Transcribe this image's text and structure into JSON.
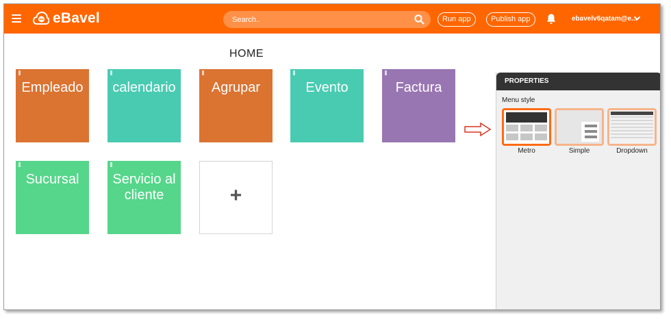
{
  "app": {
    "name": "eBavel",
    "logo_icon": "cloud-e-logo-icon"
  },
  "header": {
    "search_placeholder": "Search..",
    "run_app_label": "Run app",
    "publish_app_label": "Publish app",
    "user_email": "ebavelv6qatam@e...",
    "icons": [
      "hamburger-menu-icon",
      "search-icon",
      "bell-icon",
      "chevron-down-icon"
    ]
  },
  "home": {
    "title": "HOME",
    "tiles": [
      {
        "label": "Empleado",
        "color": "#db7331"
      },
      {
        "label": "calendario",
        "color": "#49cbb1"
      },
      {
        "label": "Agrupar",
        "color": "#db7331"
      },
      {
        "label": "Evento",
        "color": "#49cbb1"
      },
      {
        "label": "Factura",
        "color": "#9876b2"
      },
      {
        "label": "Sucursal",
        "color": "#55d68a"
      },
      {
        "label": "Servicio al cliente",
        "color": "#55d68a"
      }
    ],
    "add_tile": {
      "label": "+"
    }
  },
  "properties": {
    "title": "PROPERTIES",
    "menu_style_label": "Menu style",
    "options": [
      {
        "label": "Metro",
        "selected": true
      },
      {
        "label": "Simple",
        "selected": false
      },
      {
        "label": "Dropdown",
        "selected": false
      }
    ]
  },
  "colors": {
    "brand": "#ff6600",
    "selected_border": "#ff6a13",
    "option_border": "#f6b48a",
    "arrow": "#d9341f"
  }
}
